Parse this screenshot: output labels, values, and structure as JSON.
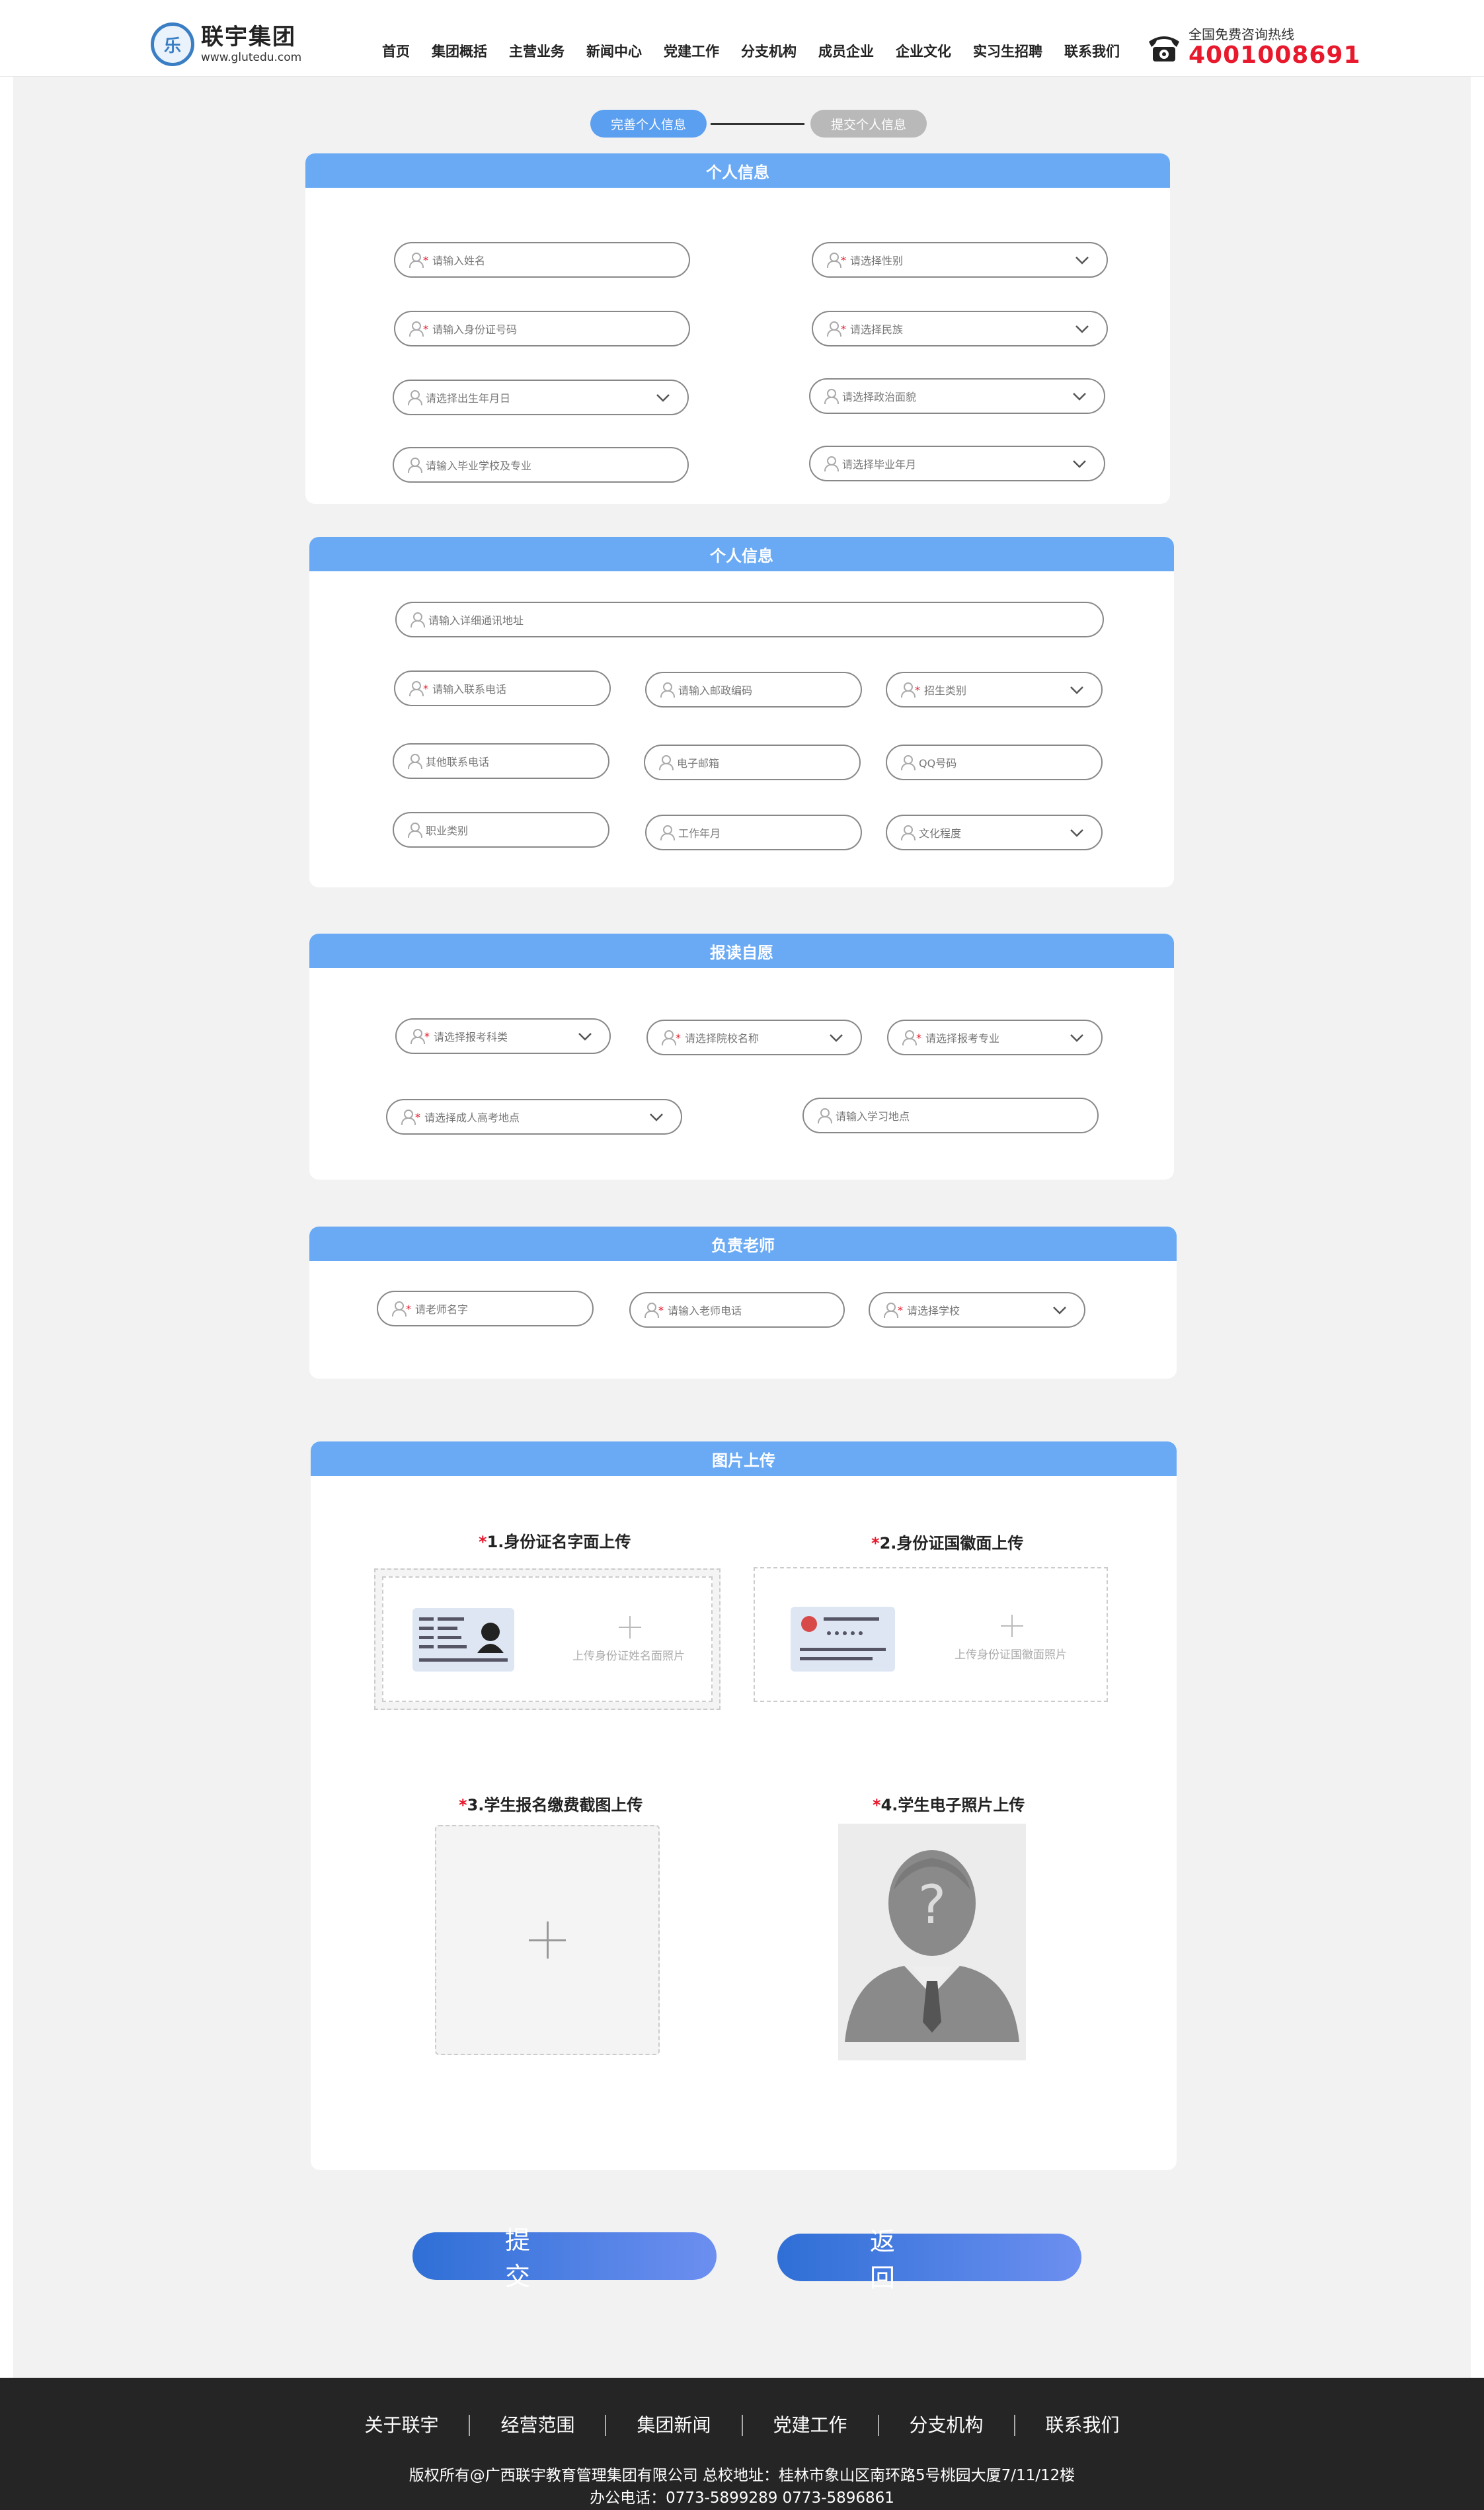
{
  "header": {
    "logo_name": "联宇集团",
    "logo_url": "www.glutedu.com",
    "nav": [
      "首页",
      "集团概括",
      "主营业务",
      "新闻中心",
      "党建工作",
      "分支机构",
      "成员企业",
      "企业文化",
      "实习生招聘",
      "联系我们"
    ],
    "hotline_label": "全国免费咨询热线",
    "hotline_number": "4001008691"
  },
  "steps": {
    "step1": "完善个人信息",
    "step2": "提交个人信息"
  },
  "sections": {
    "personal": {
      "title": "个人信息",
      "fields": [
        {
          "label": "请输入姓名",
          "required": true,
          "dropdown": false
        },
        {
          "label": "请选择性别",
          "required": true,
          "dropdown": true
        },
        {
          "label": "请输入身份证号码",
          "required": true,
          "dropdown": false
        },
        {
          "label": "请选择民族",
          "required": true,
          "dropdown": true
        },
        {
          "label": "请选择出生年月日",
          "required": false,
          "dropdown": true
        },
        {
          "label": "请选择政治面貌",
          "required": false,
          "dropdown": true
        },
        {
          "label": "请输入毕业学校及专业",
          "required": false,
          "dropdown": false
        },
        {
          "label": "请选择毕业年月",
          "required": false,
          "dropdown": true
        }
      ]
    },
    "contact": {
      "title": "个人信息",
      "fields": [
        {
          "label": "请输入详细通讯地址",
          "required": false,
          "dropdown": false
        },
        {
          "label": "请输入联系电话",
          "required": true,
          "dropdown": false
        },
        {
          "label": "请输入邮政编码",
          "required": false,
          "dropdown": false
        },
        {
          "label": "招生类别",
          "required": true,
          "dropdown": true
        },
        {
          "label": "其他联系电话",
          "required": false,
          "dropdown": false
        },
        {
          "label": "电子邮箱",
          "required": false,
          "dropdown": false
        },
        {
          "label": "QQ号码",
          "required": false,
          "dropdown": false
        },
        {
          "label": "职业类别",
          "required": false,
          "dropdown": false
        },
        {
          "label": "工作年月",
          "required": false,
          "dropdown": false
        },
        {
          "label": "文化程度",
          "required": false,
          "dropdown": true
        }
      ]
    },
    "apply": {
      "title": "报读自愿",
      "fields": [
        {
          "label": "请选择报考科类",
          "required": true,
          "dropdown": true
        },
        {
          "label": "请选择院校名称",
          "required": true,
          "dropdown": true
        },
        {
          "label": "请选择报考专业",
          "required": true,
          "dropdown": true
        },
        {
          "label": "请选择成人高考地点",
          "required": true,
          "dropdown": true
        },
        {
          "label": "请输入学习地点",
          "required": false,
          "dropdown": false
        }
      ]
    },
    "teacher": {
      "title": "负责老师",
      "fields": [
        {
          "label": "请老师名字",
          "required": true,
          "dropdown": false
        },
        {
          "label": "请输入老师电话",
          "required": true,
          "dropdown": false
        },
        {
          "label": "请选择学校",
          "required": true,
          "dropdown": true
        }
      ]
    },
    "upload": {
      "title": "图片上传",
      "items": [
        {
          "title": "1.身份证名字面上传",
          "hint": "上传身份证姓名面照片"
        },
        {
          "title": "2.身份证国徽面上传",
          "hint": "上传身份证国徽面照片"
        },
        {
          "title": "3.学生报名缴费截图上传",
          "hint": ""
        },
        {
          "title": "4.学生电子照片上传",
          "hint": ""
        }
      ]
    }
  },
  "buttons": {
    "submit": "提交",
    "back": "返回"
  },
  "footer": {
    "links": [
      "关于联宇",
      "经营范围",
      "集团新闻",
      "党建工作",
      "分支机构",
      "联系我们"
    ],
    "copyright": "版权所有@广西联宇教育管理集团有限公司    总校地址：桂林市象山区南环路5号桃园大厦7/11/12楼",
    "phone": "办公电话：0773-5899289 0773-5896861"
  },
  "colors": {
    "panel_header": "#6aaaf5",
    "step_active": "#5b9ff0",
    "step_inactive": "#b9b9b9",
    "hotline": "#e8192c",
    "footer_bg": "#252525"
  }
}
